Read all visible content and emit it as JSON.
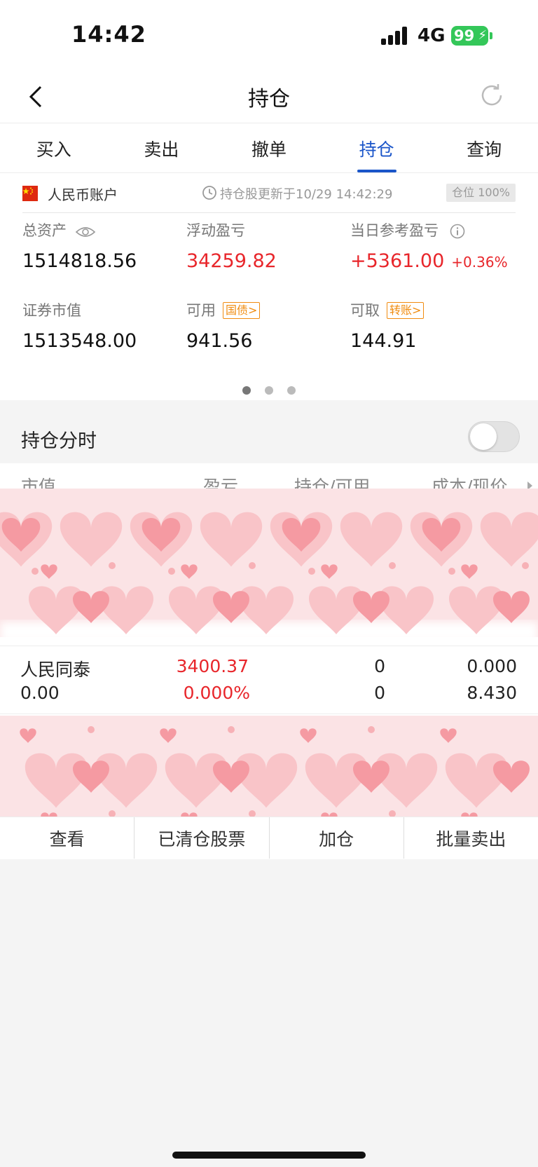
{
  "status_bar": {
    "time": "14:42",
    "network": "4G",
    "battery": "99"
  },
  "nav": {
    "title": "持仓"
  },
  "tabs": [
    {
      "label": "买入",
      "active": false
    },
    {
      "label": "卖出",
      "active": false
    },
    {
      "label": "撤单",
      "active": false
    },
    {
      "label": "持仓",
      "active": true
    },
    {
      "label": "查询",
      "active": false
    }
  ],
  "account": {
    "name": "人民币账户",
    "update_text": "持仓股更新于10/29 14:42:29",
    "position_badge": "仓位 100%"
  },
  "summary": {
    "total_assets_label": "总资产",
    "total_assets": "1514818.56",
    "floating_pl_label": "浮动盈亏",
    "floating_pl": "34259.82",
    "daily_pl_label": "当日参考盈亏",
    "daily_pl": "+5361.00",
    "daily_pl_pct": "+0.36%",
    "market_value_label": "证券市值",
    "market_value": "1513548.00",
    "available_label": "可用",
    "available_tag": "国债>",
    "available": "941.56",
    "withdrawable_label": "可取",
    "withdrawable_tag": "转账>",
    "withdrawable": "144.91",
    "page_count": 3,
    "active_page": 0
  },
  "realtime": {
    "label": "持仓分时",
    "enabled": false
  },
  "table": {
    "headers": [
      "市值",
      "盈亏",
      "持仓/可用",
      "成本/现价"
    ],
    "rows": [
      {
        "name": "人民同泰",
        "market_value": "0.00",
        "pl": "3400.37",
        "pl_pct": "0.000%",
        "holding": "0",
        "available": "0",
        "cost": "0.000",
        "price": "8.430"
      }
    ]
  },
  "actions": [
    "查看",
    "已清仓股票",
    "加仓",
    "批量卖出"
  ],
  "colors": {
    "accent": "#1a55c9",
    "profit": "#e8262b",
    "tag": "#f08c10"
  }
}
